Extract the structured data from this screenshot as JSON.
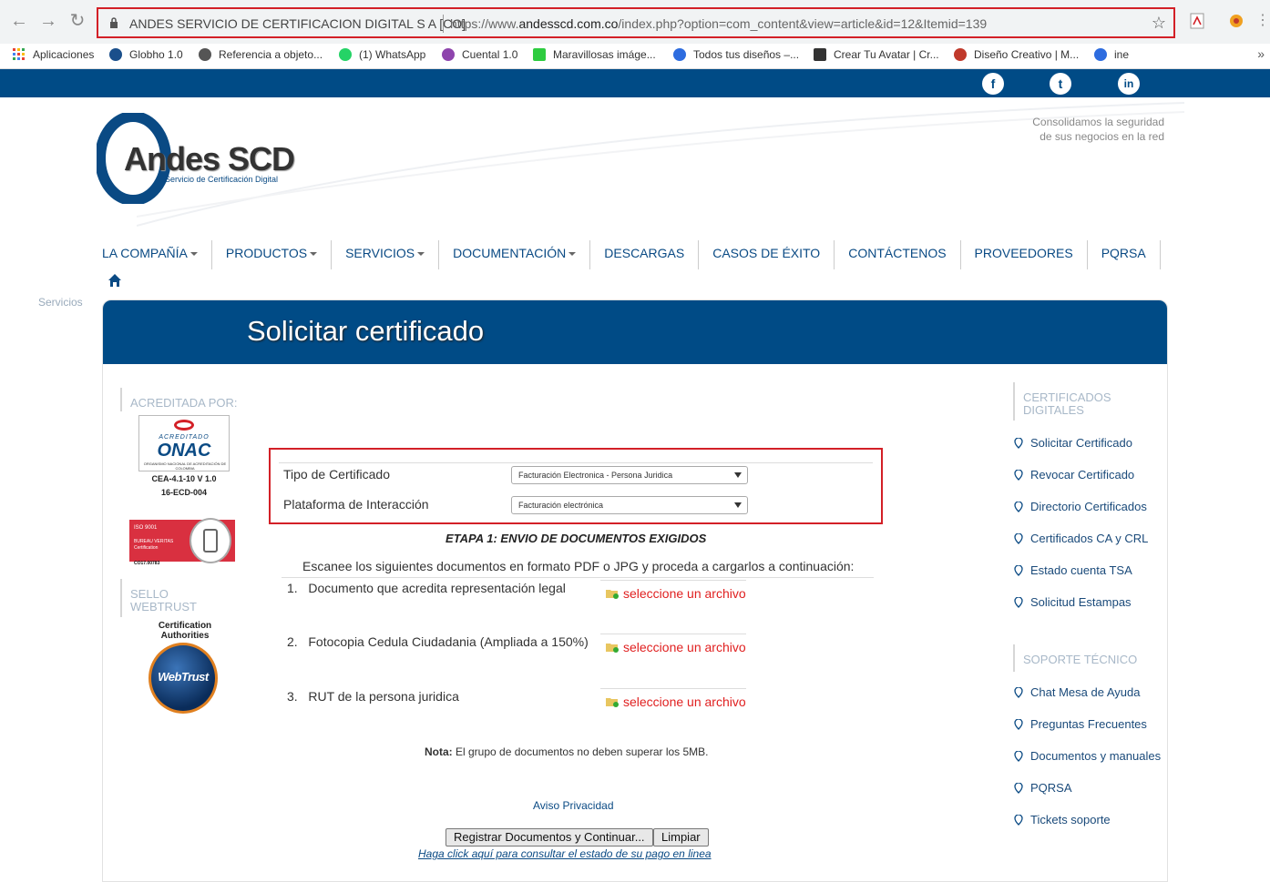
{
  "browser": {
    "site_name": "ANDES SERVICIO DE CERTIFICACION DIGITAL S A [CO]",
    "url_prefix": "https://www.",
    "url_domain": "andesscd.com.co",
    "url_path": "/index.php?option=com_content&view=article&id=12&Itemid=139"
  },
  "bookmarks": [
    {
      "label": "Aplicaciones",
      "color": "#e94235"
    },
    {
      "label": "Globho 1.0",
      "color": "#1a4f8b"
    },
    {
      "label": "Referencia a objeto...",
      "color": "#555555"
    },
    {
      "label": "(1) WhatsApp",
      "color": "#25d366"
    },
    {
      "label": "Cuental 1.0",
      "color": "#8e44ad"
    },
    {
      "label": "Maravillosas imáge...",
      "color": "#2ecc40"
    },
    {
      "label": "Todos tus diseños –...",
      "color": "#2d6cdf"
    },
    {
      "label": "Crear Tu Avatar | Cr...",
      "color": "#333333"
    },
    {
      "label": "Diseño Creativo | M...",
      "color": "#c0392b"
    },
    {
      "label": "ine",
      "color": "#2d6cdf"
    }
  ],
  "header": {
    "logo_text": "Andes SCD",
    "logo_sub": "Servicio de Certificación Digital",
    "slogan_line1": "Consolidamos la seguridad",
    "slogan_line2": "de sus negocios en la red"
  },
  "social": {
    "facebook": "f",
    "twitter": "t",
    "linkedin": "in"
  },
  "menu": [
    {
      "label": "LA COMPAÑÍA",
      "dropdown": true
    },
    {
      "label": "PRODUCTOS",
      "dropdown": true
    },
    {
      "label": "SERVICIOS",
      "dropdown": true
    },
    {
      "label": "DOCUMENTACIÓN",
      "dropdown": true
    },
    {
      "label": "DESCARGAS",
      "dropdown": false
    },
    {
      "label": "CASOS DE ÉXITO",
      "dropdown": false
    },
    {
      "label": "CONTÁCTENOS",
      "dropdown": false
    },
    {
      "label": "PROVEEDORES",
      "dropdown": false
    },
    {
      "label": "PQRSA",
      "dropdown": false
    }
  ],
  "breadcrumb_left": "Servicios",
  "page_title": "Solicitar certificado",
  "left_sidebar": {
    "accredited_heading": "ACREDITADA POR:",
    "onac_top": "ACREDITADO",
    "onac_name": "ONAC",
    "onac_sub": "ORGANISMO NACIONAL DE ACREDITACIÓN DE COLOMBIA",
    "onac_code1": "CEA-4.1-10 V 1.0",
    "onac_code2": "16-ECD-004",
    "bv_iso": "ISO 9001",
    "bv_name": "BUREAU VERITAS",
    "bv_cert": "Certification",
    "bv_code": "CO17.00783",
    "seal_heading_1": "SELLO",
    "seal_heading_2": "WEBTRUST",
    "webtrust_cap1": "Certification",
    "webtrust_cap2": "Authorities",
    "webtrust_logo": "WebTrust"
  },
  "form": {
    "cert_type_label": "Tipo de Certificado",
    "cert_type_value": "Facturación Electronica - Persona Juridica",
    "platform_label": "Plataforma de Interacción",
    "platform_value": "Facturación electrónica",
    "stage_title": "ETAPA 1: ENVIO DE DOCUMENTOS EXIGIDOS",
    "instructions": "Escanee los siguientes documentos en formato PDF o JPG y proceda a cargarlos a continuación:",
    "documents": [
      {
        "num": "1.",
        "label": "Documento que acredita representación legal",
        "link": "seleccione un archivo"
      },
      {
        "num": "2.",
        "label": "Fotocopia Cedula Ciudadania (Ampliada a 150%)",
        "link": "seleccione un archivo"
      },
      {
        "num": "3.",
        "label": "RUT de la persona juridica",
        "link": "seleccione un archivo"
      }
    ],
    "note_label": "Nota:",
    "note_text": " El grupo de documentos no deben superar los 5MB.",
    "privacy": "Aviso Privacidad",
    "submit_button": "Registrar Documentos y Continuar...",
    "clear_button": "Limpiar",
    "payment_link": "Haga click aquí para consultar el estado de su pago en linea"
  },
  "right_sidebar": {
    "certificates_heading_1": "CERTIFICADOS",
    "certificates_heading_2": "DIGITALES",
    "certificates_items": [
      "Solicitar Certificado",
      "Revocar Certificado",
      "Directorio Certificados",
      "Certificados CA y CRL",
      "Estado cuenta TSA",
      "Solicitud Estampas"
    ],
    "support_heading": "SOPORTE TÉCNICO",
    "support_items": [
      "Chat Mesa de Ayuda",
      "Preguntas Frecuentes",
      "Documentos y manuales",
      "PQRSA",
      "Tickets soporte"
    ]
  },
  "colors": {
    "brand_blue": "#004b86",
    "highlight_red": "#d32027",
    "link_red": "#e02020"
  }
}
